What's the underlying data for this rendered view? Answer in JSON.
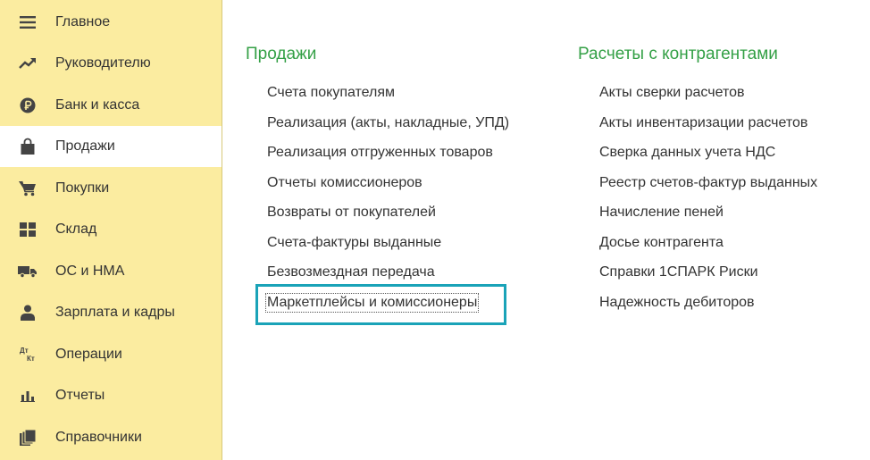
{
  "sidebar": {
    "items": [
      {
        "label": "Главное",
        "icon": "menu-lines-icon",
        "active": false
      },
      {
        "label": "Руководителю",
        "icon": "trend-up-icon",
        "active": false
      },
      {
        "label": "Банк и касса",
        "icon": "ruble-coin-icon",
        "active": false
      },
      {
        "label": "Продажи",
        "icon": "shopping-bag-icon",
        "active": true
      },
      {
        "label": "Покупки",
        "icon": "shopping-cart-icon",
        "active": false
      },
      {
        "label": "Склад",
        "icon": "warehouse-grid-icon",
        "active": false
      },
      {
        "label": "ОС и НМА",
        "icon": "truck-icon",
        "active": false
      },
      {
        "label": "Зарплата и кадры",
        "icon": "person-icon",
        "active": false
      },
      {
        "label": "Операции",
        "icon": "debit-credit-icon",
        "active": false,
        "icon_text": {
          "top": "Дт",
          "bottom": "Кт"
        }
      },
      {
        "label": "Отчеты",
        "icon": "bar-chart-icon",
        "active": false
      },
      {
        "label": "Справочники",
        "icon": "books-icon",
        "active": false
      }
    ]
  },
  "sections": {
    "sales": {
      "title": "Продажи",
      "links": [
        "Счета покупателям",
        "Реализация (акты, накладные, УПД)",
        "Реализация отгруженных товаров",
        "Отчеты комиссионеров",
        "Возвраты от покупателей",
        "Счета-фактуры выданные",
        "Безвозмездная передача",
        "Маркетплейсы и комиссионеры"
      ]
    },
    "settlements": {
      "title": "Расчеты с контрагентами",
      "links": [
        "Акты сверки расчетов",
        "Акты инвентаризации расчетов",
        "Сверка данных учета НДС",
        "Реестр счетов-фактур выданных",
        "Начисление пеней",
        "Досье контрагента",
        "Справки 1СПАРК Риски",
        "Надежность дебиторов"
      ]
    }
  },
  "colors": {
    "sidebar_bg": "#fbeca0",
    "section_title": "#34a046",
    "highlight_border": "#1aa3b8",
    "text": "#333333"
  }
}
